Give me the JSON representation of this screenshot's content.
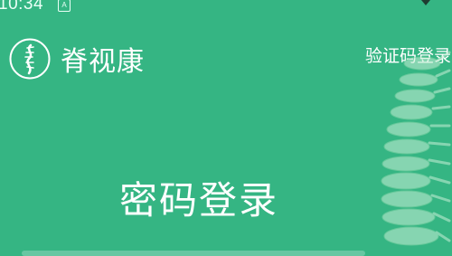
{
  "status_bar": {
    "time": "10:34",
    "notification_glyph": "A",
    "icons": [
      "notification-icon",
      "signal-icon"
    ]
  },
  "brand": {
    "logo_icon": "spine-logo-icon",
    "name": "脊视康"
  },
  "header": {
    "verify_code_login_label": "验证码登录"
  },
  "main": {
    "heading": "密码登录"
  },
  "colors": {
    "background": "#35b583",
    "text": "#ffffff"
  }
}
